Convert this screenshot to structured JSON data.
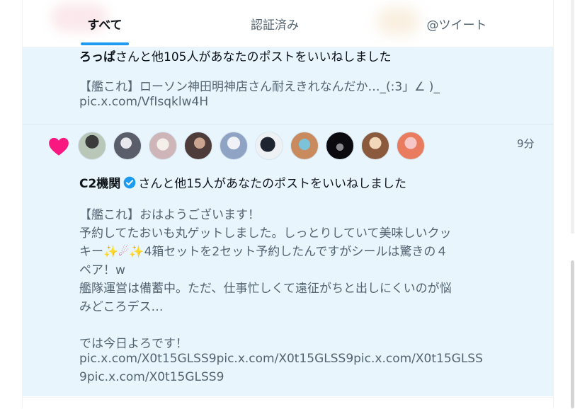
{
  "tabs": [
    {
      "label": "すべて",
      "active": true
    },
    {
      "label": "認証済み",
      "active": false
    },
    {
      "label": "@ツイート",
      "active": false
    }
  ],
  "notifications": [
    {
      "actor": "ろっぱ",
      "action": "さんと他105人があなたのポストをいいねしました",
      "post_lines": [
        "【艦これ】ローソン神田明神店さん耐えきれなんだか…_(:3」∠ )_",
        "pic.x.com/VfIsqklw4H"
      ]
    },
    {
      "actor": "C2機関",
      "action": "さんと他15人があなたのポストをいいねしました",
      "timestamp": "9分",
      "icon": "heart-icon",
      "verified_icon": "verified-badge-icon",
      "avatar_count": 10,
      "post_lines": [
        "【艦これ】おはようございます！",
        "予約してたおいも丸ゲットしました。しっとりしていて美味しいクッ",
        "キー",
        "4箱セットを2セット予約したんですがシールは驚きの４",
        "ペア！w",
        "艦隊運営は備蓄中。ただ、仕事忙しくて遠征がちと出しにくいのが悩",
        "みどころデス…",
        "では今日よろです！",
        "pic.x.com/X0t15GLSS9pic.x.com/X0t15GLSS9pic.x.com/X0t15GLSS",
        "9pic.x.com/X0t15GLSS9"
      ]
    }
  ],
  "colors": {
    "accent": "#1d9bf0",
    "heart": "#f91880",
    "unread_bg": "#e8f5fd",
    "secondary_text": "#536471"
  }
}
